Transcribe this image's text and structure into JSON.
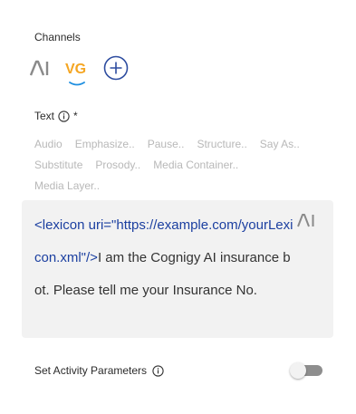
{
  "channels": {
    "label": "Channels",
    "items": [
      {
        "name": "AI",
        "icon": "ai-channel-icon",
        "color": "#8a8a8a"
      },
      {
        "name": "VG",
        "icon": "vg-channel-icon",
        "color": "#f5a623",
        "underline_color": "#1f8fe0"
      }
    ],
    "add_icon": "plus-circle-icon",
    "add_color": "#2e4da0"
  },
  "text_field": {
    "label": "Text",
    "required_mark": "*",
    "info_icon": "info-icon",
    "ssml_tags": [
      "Audio",
      "Emphasize..",
      "Pause..",
      "Structure..",
      "Say As..",
      "Substitute",
      "Prosody..",
      "Media Container..",
      "Media Layer.."
    ]
  },
  "editor": {
    "tag_text": "<lexicon uri=\"https://example.com/yourLexicon.xml\"/>",
    "body_text": "I am the Cognigy AI insurance bot. Please tell me your Insurance No.",
    "channel_icon": "ai-channel-icon"
  },
  "activity_params": {
    "label": "Set Activity Parameters",
    "info_icon": "info-icon",
    "toggle_on": false
  }
}
